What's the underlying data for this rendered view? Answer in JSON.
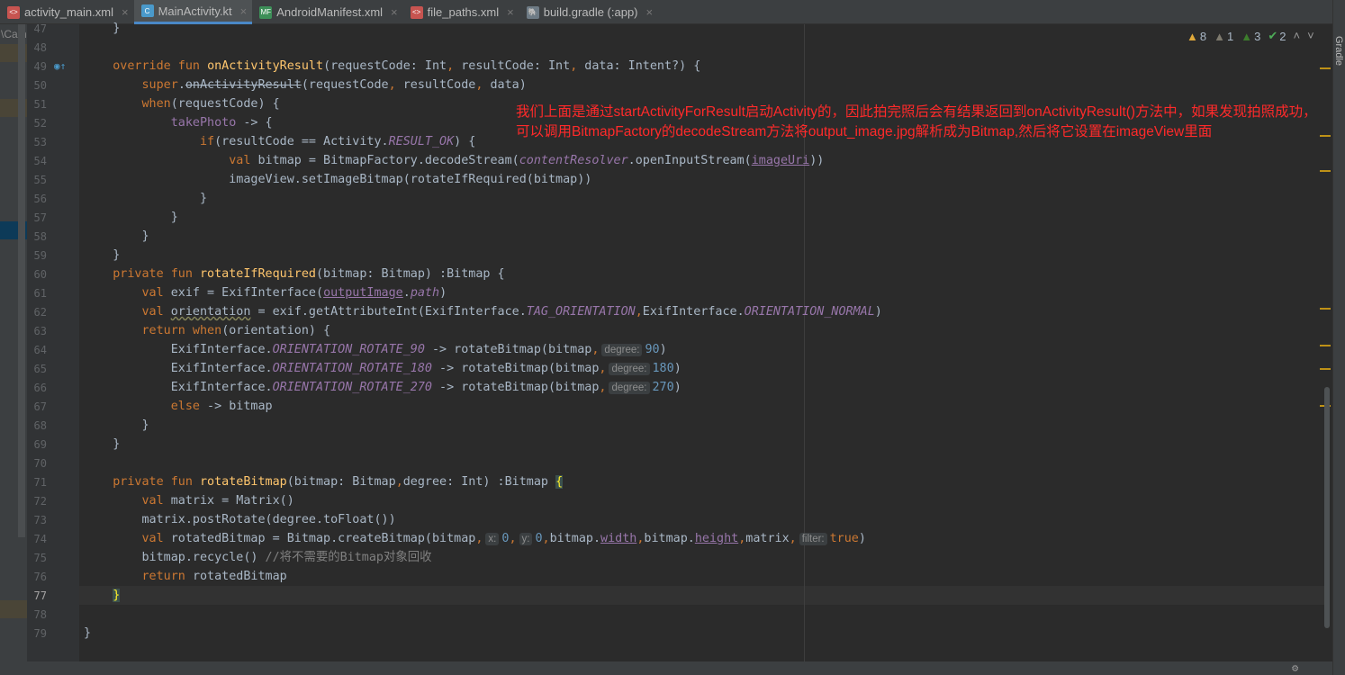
{
  "tabs": [
    {
      "label": "activity_main.xml",
      "icon": "xml-file-icon",
      "color": "#C75450",
      "glyph": "<>"
    },
    {
      "label": "MainActivity.kt",
      "icon": "kotlin-class-icon",
      "color": "#4A9ACB",
      "glyph": "C",
      "active": true
    },
    {
      "label": "AndroidManifest.xml",
      "icon": "manifest-file-icon",
      "color": "#3D8F58",
      "glyph": "MF"
    },
    {
      "label": "file_paths.xml",
      "icon": "xml-file-icon",
      "color": "#C75450",
      "glyph": "<>"
    },
    {
      "label": "build.gradle (:app)",
      "icon": "gradle-elephant-icon",
      "color": "#6E7B85",
      "glyph": "🐘"
    }
  ],
  "left_panel_text": "\\Cam",
  "inspections": {
    "warnings": "8",
    "weak_warnings": "1",
    "typos": "3",
    "ok": "2"
  },
  "gradle_label": "Gradle",
  "annotation": "我们上面是通过startActivityForResult启动Activity的，因此拍完照后会有结果返回到onActivityResult()方法中，如果发现拍照成功，可以调用BitmapFactory的decodeStream方法将output_image.jpg解析成为Bitmap,然后将它设置在imageView里面",
  "current_line": 77,
  "code": [
    {
      "n": 47,
      "t": [
        [
          "",
          "    }"
        ]
      ]
    },
    {
      "n": 48,
      "t": []
    },
    {
      "n": 49,
      "t": [
        [
          "",
          "    "
        ],
        [
          "kw",
          "override fun "
        ],
        [
          "fn",
          "onActivityResult"
        ],
        [
          "",
          "(requestCode: Int"
        ],
        [
          "kw",
          ","
        ],
        [
          "",
          " resultCode: Int"
        ],
        [
          "kw",
          ","
        ],
        [
          "",
          " data: Intent?) {"
        ]
      ]
    },
    {
      "n": 50,
      "t": [
        [
          "",
          "        "
        ],
        [
          "kw",
          "super"
        ],
        [
          "",
          "."
        ],
        [
          "st",
          "onActivityResult"
        ],
        [
          "",
          "(requestCode"
        ],
        [
          "kw",
          ","
        ],
        [
          "",
          " resultCode"
        ],
        [
          "kw",
          ","
        ],
        [
          "",
          " data)"
        ]
      ]
    },
    {
      "n": 51,
      "t": [
        [
          "",
          "        "
        ],
        [
          "kw",
          "when"
        ],
        [
          "",
          "(requestCode) {"
        ]
      ]
    },
    {
      "n": 52,
      "t": [
        [
          "",
          "            "
        ],
        [
          "pr",
          "takePhoto"
        ],
        [
          "",
          " -> {"
        ]
      ]
    },
    {
      "n": 53,
      "t": [
        [
          "",
          "                "
        ],
        [
          "kw",
          "if"
        ],
        [
          "",
          "(resultCode == Activity."
        ],
        [
          "pi",
          "RESULT_OK"
        ],
        [
          "",
          ") {"
        ]
      ]
    },
    {
      "n": 54,
      "t": [
        [
          "",
          "                    "
        ],
        [
          "kw",
          "val "
        ],
        [
          "",
          "bitmap = BitmapFactory.decodeStream("
        ],
        [
          "pi",
          "contentResolver"
        ],
        [
          "",
          ".openInputStream("
        ],
        [
          "pu",
          "imageUri"
        ],
        [
          "",
          "))"
        ]
      ]
    },
    {
      "n": 55,
      "t": [
        [
          "",
          "                    imageView.setImageBitmap(rotateIfRequired(bitmap))"
        ]
      ]
    },
    {
      "n": 56,
      "t": [
        [
          "",
          "                }"
        ]
      ]
    },
    {
      "n": 57,
      "t": [
        [
          "",
          "            }"
        ]
      ]
    },
    {
      "n": 58,
      "t": [
        [
          "",
          "        }"
        ]
      ]
    },
    {
      "n": 59,
      "t": [
        [
          "",
          "    }"
        ]
      ]
    },
    {
      "n": 60,
      "t": [
        [
          "",
          "    "
        ],
        [
          "kw",
          "private fun "
        ],
        [
          "fn",
          "rotateIfRequired"
        ],
        [
          "",
          "(bitmap: Bitmap) :Bitmap {"
        ]
      ]
    },
    {
      "n": 61,
      "t": [
        [
          "",
          "        "
        ],
        [
          "kw",
          "val "
        ],
        [
          "",
          "exif = ExifInterface("
        ],
        [
          "pu",
          "outputImage"
        ],
        [
          "",
          "."
        ],
        [
          "pi",
          "path"
        ],
        [
          "",
          ")"
        ]
      ]
    },
    {
      "n": 62,
      "t": [
        [
          "",
          "        "
        ],
        [
          "kw",
          "val "
        ],
        [
          "wv",
          "orientation"
        ],
        [
          "",
          " = exif.getAttributeInt(ExifInterface."
        ],
        [
          "pi",
          "TAG_ORIENTATION"
        ],
        [
          "kw",
          ","
        ],
        [
          "",
          "ExifInterface."
        ],
        [
          "pi",
          "ORIENTATION_NORMAL"
        ],
        [
          "",
          ")"
        ]
      ]
    },
    {
      "n": 63,
      "t": [
        [
          "",
          "        "
        ],
        [
          "kw",
          "return when"
        ],
        [
          "",
          "(orientation) {"
        ]
      ]
    },
    {
      "n": 64,
      "t": [
        [
          "",
          "            ExifInterface."
        ],
        [
          "pi",
          "ORIENTATION_ROTATE_90"
        ],
        [
          "",
          " -> rotateBitmap(bitmap"
        ],
        [
          "kw",
          ","
        ],
        [
          "hint",
          "degree:"
        ],
        [
          "num",
          "90"
        ],
        [
          "",
          ")"
        ]
      ]
    },
    {
      "n": 65,
      "t": [
        [
          "",
          "            ExifInterface."
        ],
        [
          "pi",
          "ORIENTATION_ROTATE_180"
        ],
        [
          "",
          " -> rotateBitmap(bitmap"
        ],
        [
          "kw",
          ","
        ],
        [
          "hint",
          "degree:"
        ],
        [
          "num",
          "180"
        ],
        [
          "",
          ")"
        ]
      ]
    },
    {
      "n": 66,
      "t": [
        [
          "",
          "            ExifInterface."
        ],
        [
          "pi",
          "ORIENTATION_ROTATE_270"
        ],
        [
          "",
          " -> rotateBitmap(bitmap"
        ],
        [
          "kw",
          ","
        ],
        [
          "hint",
          "degree:"
        ],
        [
          "num",
          "270"
        ],
        [
          "",
          ")"
        ]
      ]
    },
    {
      "n": 67,
      "t": [
        [
          "",
          "            "
        ],
        [
          "kw",
          "else"
        ],
        [
          "",
          " -> bitmap"
        ]
      ]
    },
    {
      "n": 68,
      "t": [
        [
          "",
          "        }"
        ]
      ]
    },
    {
      "n": 69,
      "t": [
        [
          "",
          "    }"
        ]
      ]
    },
    {
      "n": 70,
      "t": []
    },
    {
      "n": 71,
      "t": [
        [
          "",
          "    "
        ],
        [
          "kw",
          "private fun "
        ],
        [
          "fn",
          "rotateBitmap"
        ],
        [
          "",
          "(bitmap: Bitmap"
        ],
        [
          "kw",
          ","
        ],
        [
          "",
          "degree: Int) :Bitmap "
        ],
        [
          "br",
          "{"
        ]
      ]
    },
    {
      "n": 72,
      "t": [
        [
          "",
          "        "
        ],
        [
          "kw",
          "val "
        ],
        [
          "",
          "matrix = Matrix()"
        ]
      ]
    },
    {
      "n": 73,
      "t": [
        [
          "",
          "        matrix.postRotate(degree.toFloat())"
        ]
      ]
    },
    {
      "n": 74,
      "t": [
        [
          "",
          "        "
        ],
        [
          "kw",
          "val "
        ],
        [
          "",
          "rotatedBitmap = Bitmap.createBitmap(bitmap"
        ],
        [
          "kw",
          ","
        ],
        [
          "hint",
          "x:"
        ],
        [
          "num",
          "0"
        ],
        [
          "kw",
          ","
        ],
        [
          "hint",
          "y:"
        ],
        [
          "num",
          "0"
        ],
        [
          "kw",
          ","
        ],
        [
          "",
          "bitmap."
        ],
        [
          "pu",
          "width"
        ],
        [
          "kw",
          ","
        ],
        [
          "",
          "bitmap."
        ],
        [
          "pu",
          "height"
        ],
        [
          "kw",
          ","
        ],
        [
          "",
          "matrix"
        ],
        [
          "kw",
          ","
        ],
        [
          "hint",
          "filter:"
        ],
        [
          "kw",
          "true"
        ],
        [
          "",
          ")"
        ]
      ]
    },
    {
      "n": 75,
      "t": [
        [
          "",
          "        bitmap.recycle() "
        ],
        [
          "cm",
          "//将不需要的Bitmap对象回收"
        ]
      ]
    },
    {
      "n": 76,
      "t": [
        [
          "",
          "        "
        ],
        [
          "kw",
          "return "
        ],
        [
          "",
          "rotatedBitmap"
        ]
      ]
    },
    {
      "n": 77,
      "t": [
        [
          "",
          "    "
        ],
        [
          "br",
          "}"
        ]
      ]
    },
    {
      "n": 78,
      "t": []
    },
    {
      "n": 79,
      "t": [
        [
          "",
          "}"
        ]
      ]
    }
  ]
}
